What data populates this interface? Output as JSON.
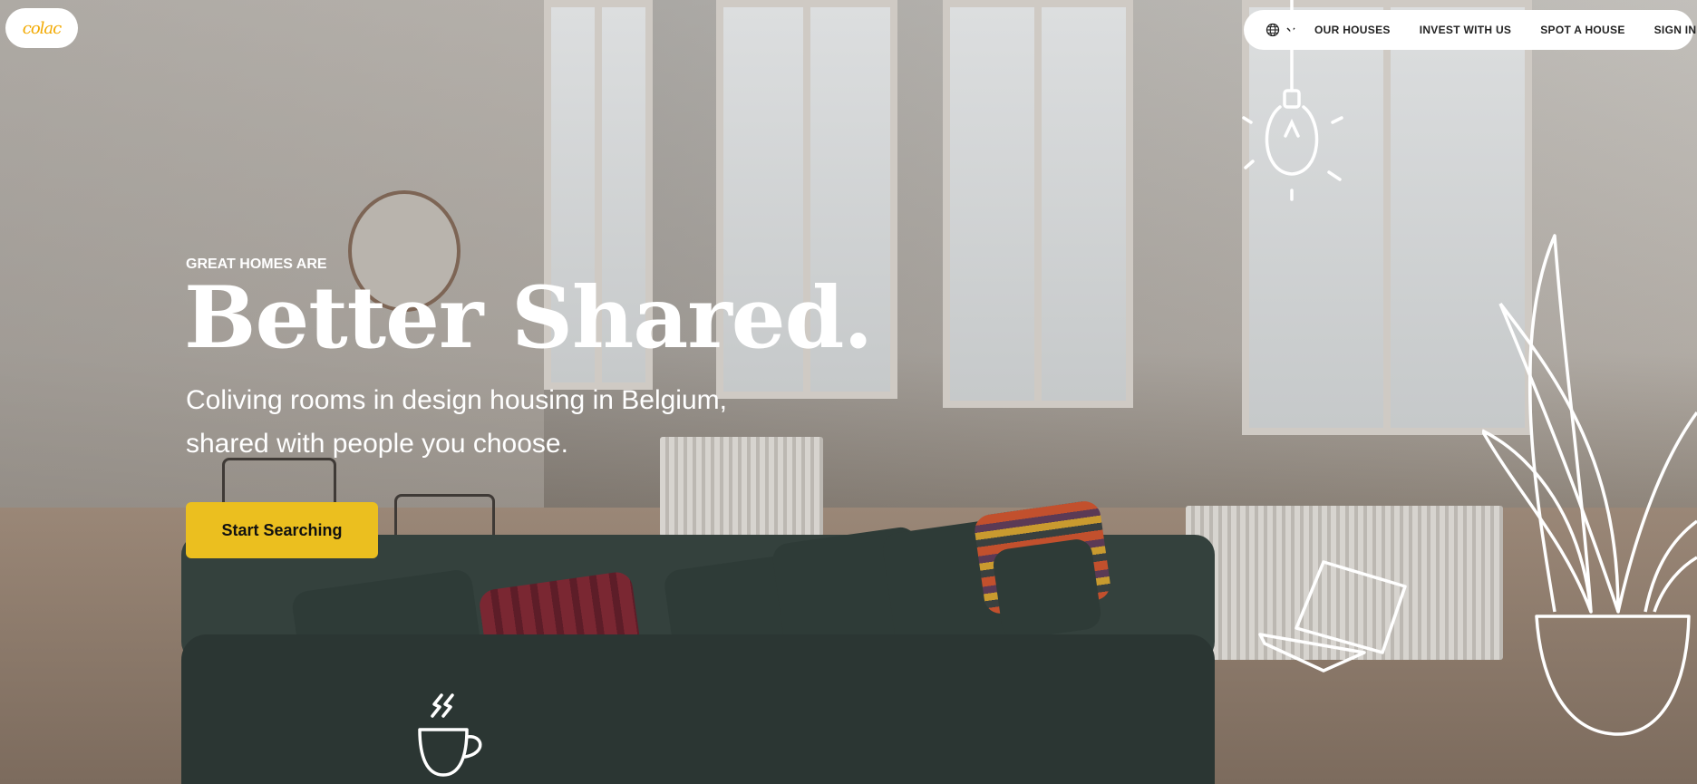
{
  "brand": {
    "logo_text": "colac",
    "accent_yellow": "#EBBF1F",
    "logo_colors": [
      "#F2A900",
      "#E94B3C"
    ]
  },
  "nav": {
    "language_icon": "globe-icon",
    "language_chevron": "chevron-down-icon",
    "items": [
      {
        "label": "OUR HOUSES"
      },
      {
        "label": "INVEST WITH US"
      },
      {
        "label": "SPOT A HOUSE"
      },
      {
        "label": "SIGN IN"
      }
    ]
  },
  "hero": {
    "eyebrow": "GREAT HOMES ARE",
    "headline": "Better Shared.",
    "subtitle": "Coliving rooms in design housing in Belgium, shared with people you choose.",
    "cta_label": "Start Searching"
  },
  "decorations": [
    "lightbulb-icon",
    "plant-icon",
    "laptop-icon",
    "coffee-cup-icon"
  ]
}
